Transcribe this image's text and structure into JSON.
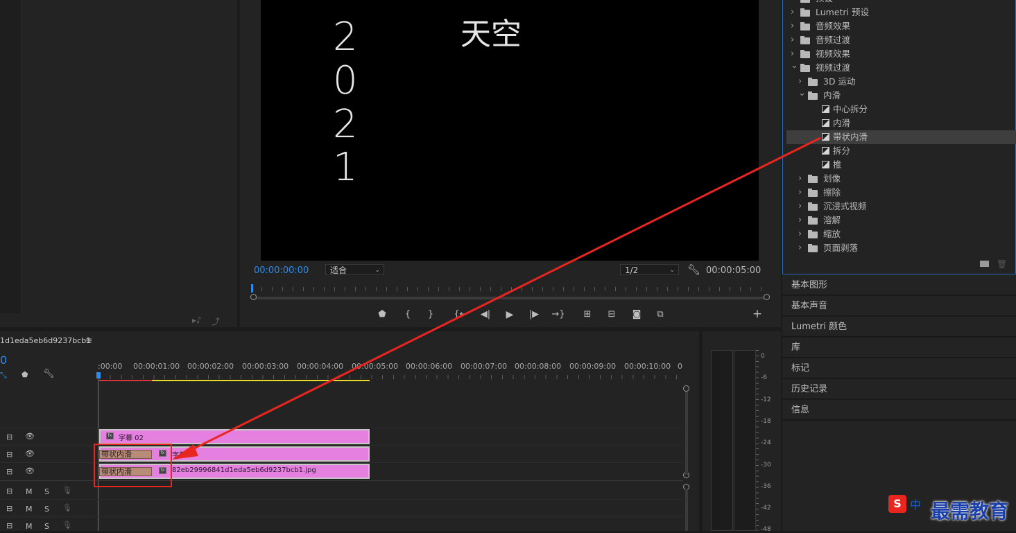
{
  "program_monitor": {
    "video_title": "天空",
    "video_year_chars": [
      "2",
      "0",
      "2",
      "1"
    ],
    "current_timecode": "00:00:00:00",
    "fit_select": "适合",
    "resolution_select": "1/2",
    "duration_timecode": "00:00:05:00"
  },
  "effects_tree": {
    "items": [
      {
        "label": "预设",
        "type": "folder",
        "indent": 0,
        "expanded": false
      },
      {
        "label": "Lumetri 预设",
        "type": "folder",
        "indent": 0,
        "expanded": false
      },
      {
        "label": "音频效果",
        "type": "folder",
        "indent": 0,
        "expanded": false
      },
      {
        "label": "音频过渡",
        "type": "folder",
        "indent": 0,
        "expanded": false
      },
      {
        "label": "视频效果",
        "type": "folder",
        "indent": 0,
        "expanded": false
      },
      {
        "label": "视频过渡",
        "type": "folder",
        "indent": 0,
        "expanded": true
      },
      {
        "label": "3D 运动",
        "type": "folder",
        "indent": 1,
        "expanded": false
      },
      {
        "label": "内滑",
        "type": "folder",
        "indent": 1,
        "expanded": true
      },
      {
        "label": "中心拆分",
        "type": "effect",
        "indent": 2
      },
      {
        "label": "内滑",
        "type": "effect",
        "indent": 2
      },
      {
        "label": "带状内滑",
        "type": "effect",
        "indent": 2,
        "selected": true
      },
      {
        "label": "拆分",
        "type": "effect",
        "indent": 2
      },
      {
        "label": "推",
        "type": "effect",
        "indent": 2
      },
      {
        "label": "划像",
        "type": "folder",
        "indent": 1,
        "expanded": false
      },
      {
        "label": "擦除",
        "type": "folder",
        "indent": 1,
        "expanded": false
      },
      {
        "label": "沉浸式视频",
        "type": "folder",
        "indent": 1,
        "expanded": false
      },
      {
        "label": "溶解",
        "type": "folder",
        "indent": 1,
        "expanded": false
      },
      {
        "label": "缩放",
        "type": "folder",
        "indent": 1,
        "expanded": false
      },
      {
        "label": "页面剥落",
        "type": "folder",
        "indent": 1,
        "expanded": false
      }
    ]
  },
  "right_panels": [
    "基本图形",
    "基本声音",
    "Lumetri 颜色",
    "库",
    "标记",
    "历史记录",
    "信息"
  ],
  "timeline": {
    "sequence_name": "1d1eda5eb6d9237bcb1",
    "playhead_timecode": "0",
    "ruler_labels": [
      ":00:00",
      "00:00:01:00",
      "00:00:02:00",
      "00:00:03:00",
      "00:00:04:00",
      "00:00:05:00",
      "00:00:06:00",
      "00:00:07:00",
      "00:00:08:00",
      "00:00:09:00",
      "00:00:10:00",
      "0"
    ],
    "clips": {
      "v3_name": "字幕 02",
      "v2_name": "字幕",
      "v1_name": "82eb29996841d1eda5eb6d9237bcb1.jpg"
    },
    "transition_label": "带状内滑",
    "audio_track_buttons": {
      "mute": "M",
      "solo": "S"
    }
  },
  "audio_meter_db": [
    "0",
    "-6",
    "-12",
    "-18",
    "-24",
    "-30",
    "-36",
    "-42",
    "-48"
  ],
  "watermark": {
    "brand": "最需教育",
    "ime": "中"
  },
  "colors": {
    "accent_blue": "#2d8ceb",
    "clip_pink": "#e580e0",
    "transition_tan": "#b98c79",
    "annotation_red": "#e8261f"
  }
}
